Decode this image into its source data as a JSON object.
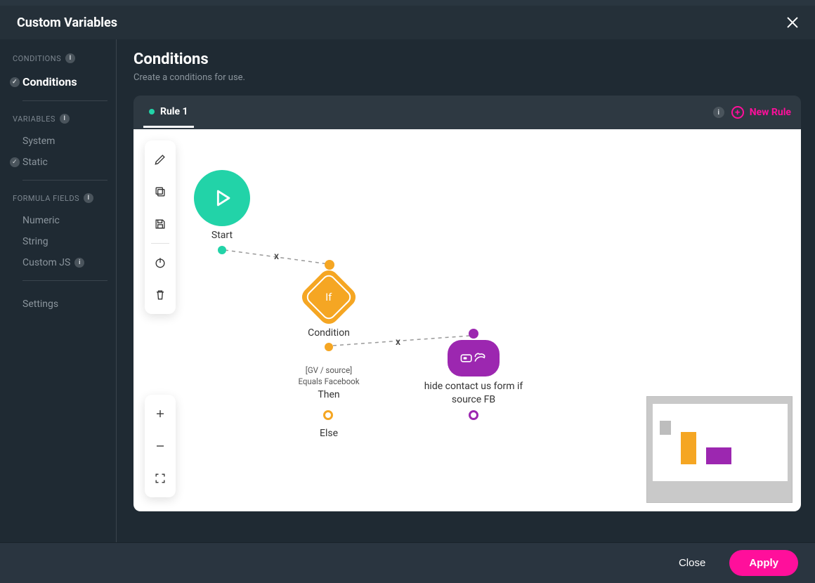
{
  "header": {
    "title": "Custom Variables"
  },
  "sidebar": {
    "section_conditions": "CONDITIONS",
    "item_conditions": "Conditions",
    "section_variables": "VARIABLES",
    "item_system": "System",
    "item_static": "Static",
    "section_formula": "FORMULA FIELDS",
    "item_numeric": "Numeric",
    "item_string": "String",
    "item_customjs": "Custom JS",
    "item_settings": "Settings"
  },
  "page": {
    "title": "Conditions",
    "subtitle": "Create a conditions for use."
  },
  "rules": {
    "tab1": "Rule 1",
    "new_rule": "New Rule"
  },
  "flow": {
    "start_label": "Start",
    "cond_label": "Condition",
    "cond_if_text": "If",
    "cond_expr_line1": "[GV / source]",
    "cond_expr_line2": "Equals Facebook",
    "then_label": "Then",
    "else_label": "Else",
    "action_label": "hide contact us form if source FB",
    "x_marker": "x"
  },
  "footer": {
    "close": "Close",
    "apply": "Apply"
  },
  "info_char": "i",
  "plus_char": "+"
}
